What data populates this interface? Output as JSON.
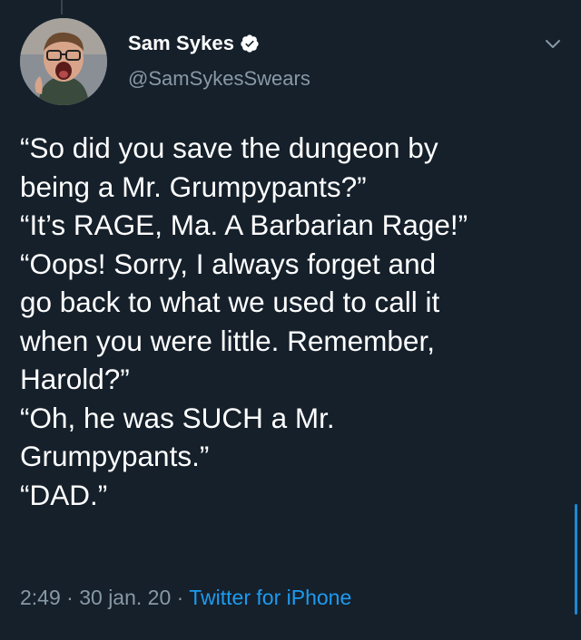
{
  "author": {
    "display_name": "Sam Sykes",
    "handle": "@SamSykesSwears",
    "verified": true
  },
  "tweet": {
    "lines": [
      "“So did you save the dungeon by",
      "being a Mr. Grumpypants?”",
      "“It’s RAGE, Ma. A Barbarian Rage!”",
      "“Oops! Sorry, I always forget and",
      "go back to what we used to call it",
      "when you were little. Remember,",
      "Harold?”",
      "“Oh, he was SUCH a Mr.",
      "Grumpypants.”",
      "“DAD.”"
    ]
  },
  "meta": {
    "time": "2:49",
    "separator": " · ",
    "date": "30 jan. 20",
    "source": "Twitter for iPhone"
  },
  "icons": {
    "verified": "verified-badge-icon",
    "menu": "chevron-down-icon"
  },
  "colors": {
    "background": "#15202b",
    "primary_text": "#ffffff",
    "secondary_text": "#8899a6",
    "accent": "#1d9bf0"
  }
}
